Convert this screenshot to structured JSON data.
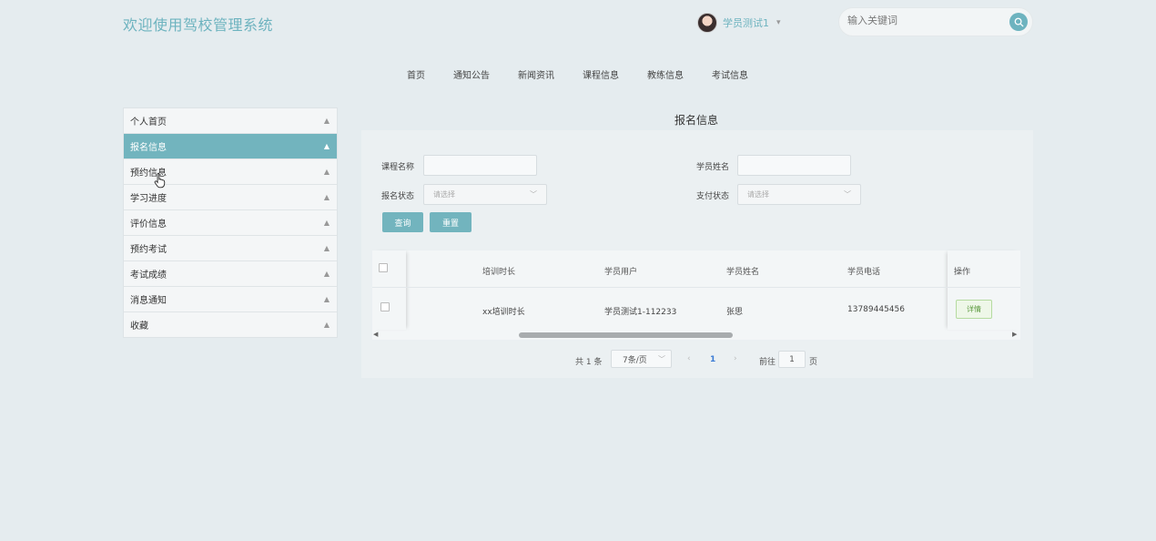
{
  "header": {
    "site_title": "欢迎使用驾校管理系统",
    "username": "学员测试1",
    "search_placeholder": "输入关键词"
  },
  "top_nav": [
    "首页",
    "通知公告",
    "新闻资讯",
    "课程信息",
    "教练信息",
    "考试信息"
  ],
  "sidebar": {
    "items": [
      {
        "label": "个人首页",
        "active": false
      },
      {
        "label": "报名信息",
        "active": true
      },
      {
        "label": "预约信息",
        "active": false
      },
      {
        "label": "学习进度",
        "active": false
      },
      {
        "label": "评价信息",
        "active": false
      },
      {
        "label": "预约考试",
        "active": false
      },
      {
        "label": "考试成绩",
        "active": false
      },
      {
        "label": "消息通知",
        "active": false
      },
      {
        "label": "收藏",
        "active": false
      }
    ]
  },
  "main": {
    "title": "报名信息",
    "filters": {
      "course_name_label": "课程名称",
      "student_name_label": "学员姓名",
      "signup_status_label": "报名状态",
      "signup_status_placeholder": "请选择",
      "pay_status_label": "支付状态",
      "pay_status_placeholder": "请选择",
      "query_button": "查询",
      "reset_button": "重置"
    },
    "table": {
      "columns": [
        "培训时长",
        "学员用户",
        "学员姓名",
        "学员电话",
        "操作"
      ],
      "rows": [
        {
          "duration": "xx培训时长",
          "user": "学员测试1-112233",
          "name": "张思",
          "phone": "13789445456",
          "action": "详情"
        }
      ]
    },
    "pagination": {
      "total": "共 1 条",
      "page_size": "7条/页",
      "current_page": "1",
      "goto_label": "前往",
      "goto_value": "1",
      "page_suffix": "页"
    }
  },
  "colors": {
    "accent": "#72b4be",
    "background": "#e5ecef"
  }
}
